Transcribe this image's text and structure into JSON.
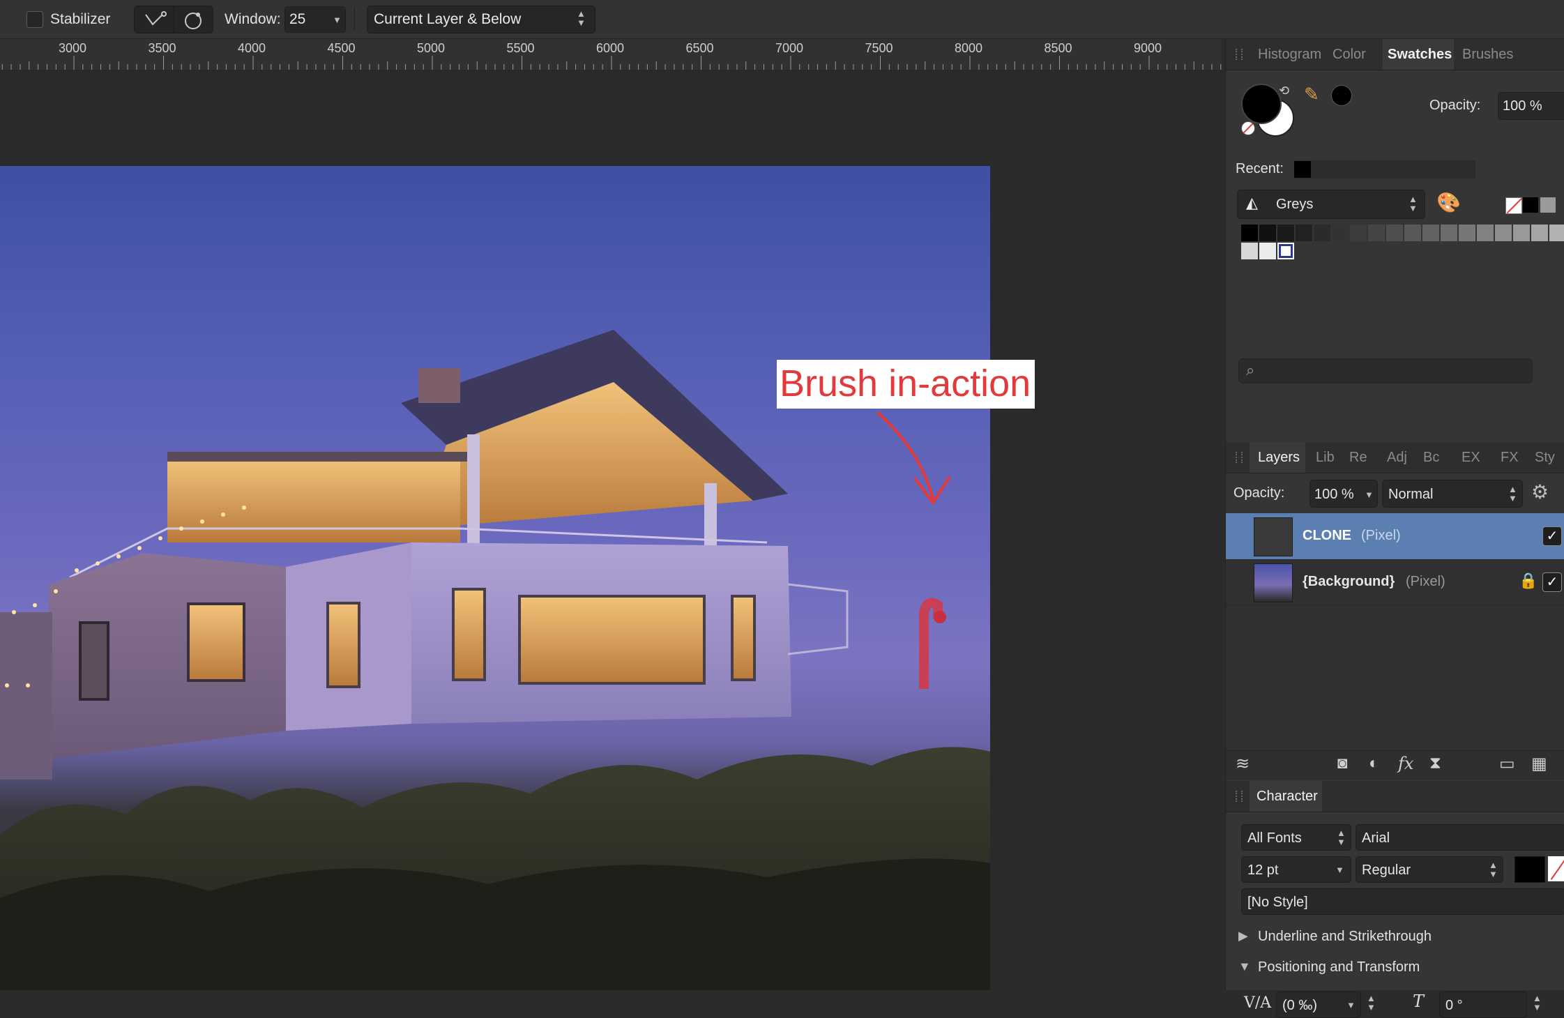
{
  "toolbar": {
    "stabilizer_label": "Stabilizer",
    "window_label": "Window:",
    "window_value": "25",
    "sample_source": "Current Layer & Below"
  },
  "ruler": {
    "labels": [
      "3000",
      "3500",
      "4000",
      "4500",
      "5000",
      "5500",
      "6000",
      "6500",
      "7000",
      "7500",
      "8000",
      "8500",
      "9000"
    ]
  },
  "canvas": {
    "annotation": "Brush in-action"
  },
  "swatches_panel": {
    "tabs": [
      "Histogram",
      "Color",
      "Swatches",
      "Brushes"
    ],
    "active_tab": "Swatches",
    "opacity_label": "Opacity:",
    "opacity_value": "100 %",
    "recent_label": "Recent:",
    "palette_name": "Greys",
    "greys": [
      "#000000",
      "#111111",
      "#1b1b1b",
      "#222222",
      "#2b2b2b",
      "#333333",
      "#3c3c3c",
      "#454545",
      "#4e4e4e",
      "#585858",
      "#626262",
      "#6c6c6c",
      "#777777",
      "#828282",
      "#8d8d8d",
      "#999999",
      "#a5a5a5",
      "#b2b2b2"
    ],
    "greys_row2": [
      "#d8d8d8",
      "#ececec",
      "#ffffff"
    ],
    "search_placeholder": ""
  },
  "layers_panel": {
    "tabs": [
      "Layers",
      "Lib",
      "Re",
      "Adj",
      "Bc",
      "EX",
      "FX",
      "Sty"
    ],
    "active_tab": "Layers",
    "opacity_label": "Opacity:",
    "opacity_value": "100 %",
    "blend_mode": "Normal",
    "layers": [
      {
        "name": "CLONE",
        "type": "(Pixel)",
        "selected": true,
        "visible": true,
        "locked": false
      },
      {
        "name": "{Background}",
        "type": "(Pixel)",
        "selected": false,
        "visible": true,
        "locked": true
      }
    ]
  },
  "character_panel": {
    "title": "Character",
    "font_collection": "All Fonts",
    "font_family": "Arial",
    "font_size": "12 pt",
    "font_style": "Regular",
    "text_style": "[No Style]",
    "section_underline": "Underline and Strikethrough",
    "section_positioning": "Positioning and Transform",
    "kerning_value": "(0 ‰)",
    "skew_value": "0 °"
  },
  "colors": {
    "accent_selected": "#5a7fb0",
    "annotation_red": "#e23a3a"
  }
}
